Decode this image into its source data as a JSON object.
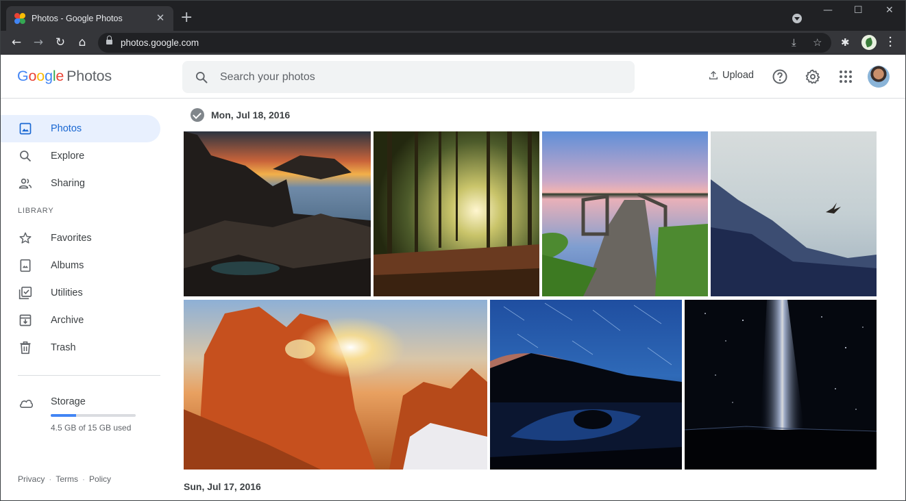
{
  "browser": {
    "tab_title": "Photos - Google Photos",
    "tab_close": "✕",
    "new_tab": "+",
    "url": "photos.google.com"
  },
  "header": {
    "logo_google": [
      "G",
      "o",
      "o",
      "g",
      "l",
      "e"
    ],
    "logo_product": "Photos",
    "search_placeholder": "Search your photos",
    "upload_label": "Upload"
  },
  "sidebar": {
    "items": [
      {
        "label": "Photos",
        "icon": "photo-icon",
        "active": true
      },
      {
        "label": "Explore",
        "icon": "search-icon"
      },
      {
        "label": "Sharing",
        "icon": "people-icon"
      }
    ],
    "library_label": "LIBRARY",
    "library_items": [
      {
        "label": "Favorites",
        "icon": "star-icon"
      },
      {
        "label": "Albums",
        "icon": "album-icon"
      },
      {
        "label": "Utilities",
        "icon": "utilities-icon"
      },
      {
        "label": "Archive",
        "icon": "archive-icon"
      },
      {
        "label": "Trash",
        "icon": "trash-icon"
      }
    ],
    "storage": {
      "label": "Storage",
      "used_text": "4.5 GB of 15 GB used",
      "used_fraction": 0.3
    },
    "footer": {
      "privacy": "Privacy",
      "terms": "Terms",
      "policy": "Policy",
      "sep": "·"
    }
  },
  "main": {
    "groups": [
      {
        "date": "Mon, Jul 18, 2016",
        "photos": [
          "coastal-rocks-sunset",
          "forest-sunbeams",
          "wooden-pier-lake",
          "misty-mountains-eagle",
          "red-rock-arch-sunset",
          "star-trails-lake",
          "milky-way-night"
        ]
      },
      {
        "date": "Sun, Jul 17, 2016"
      }
    ]
  },
  "colors": {
    "accent": "#1967d2",
    "active_bg": "#e8f0fe",
    "storage_fill": "#4285f4"
  }
}
